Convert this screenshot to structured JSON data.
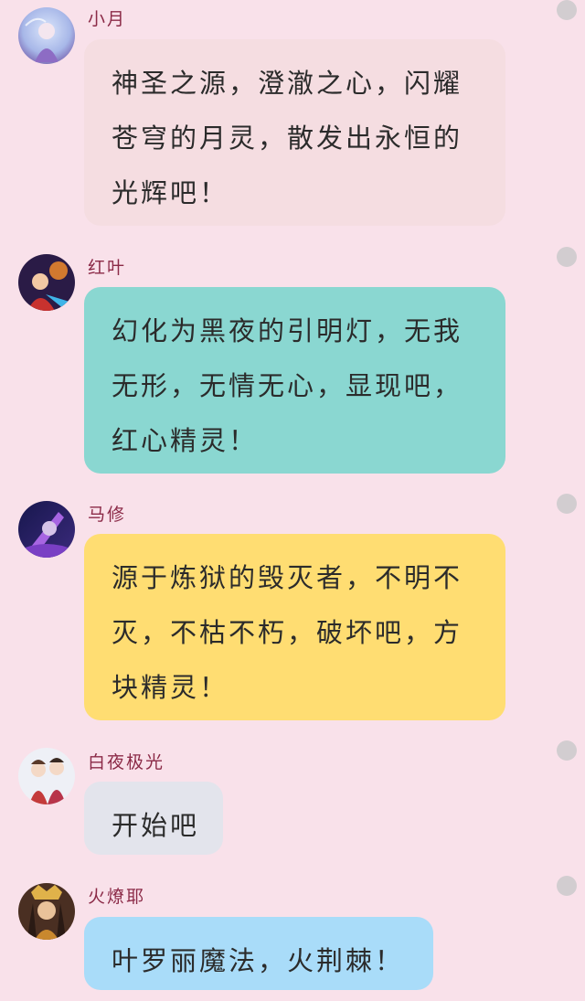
{
  "messages": [
    {
      "sender": "小月",
      "lines": [
        "神圣之源，澄澈之心，闪耀",
        "苍穹的月灵，散发出永恒的",
        "光辉吧！"
      ],
      "bubble_color": "#f5dde1",
      "avatar_colors": [
        "#c9d6f2",
        "#7e5ab0"
      ]
    },
    {
      "sender": "红叶",
      "lines": [
        "幻化为黑夜的引明灯，无我",
        "无形，无情无心，显现吧，",
        "红心精灵！"
      ],
      "bubble_color": "#8ad7d1",
      "avatar_colors": [
        "#2b1a4a",
        "#e46a2a"
      ]
    },
    {
      "sender": "马修",
      "lines": [
        "源于炼狱的毁灭者，不明不",
        "灭，不枯不朽，破坏吧，方",
        "块精灵！"
      ],
      "bubble_color": "#ffdd72",
      "avatar_colors": [
        "#1d1a5e",
        "#9a4fd1"
      ]
    },
    {
      "sender": "白夜极光",
      "lines": [
        "开始吧"
      ],
      "bubble_color": "#e3e4ec",
      "avatar_colors": [
        "#eef0f6",
        "#c23a3a"
      ]
    },
    {
      "sender": "火燎耶",
      "lines": [
        "叶罗丽魔法，火荆棘！"
      ],
      "bubble_color": "#a9dcf9",
      "avatar_colors": [
        "#5a3a2a",
        "#d9a24a"
      ]
    }
  ]
}
